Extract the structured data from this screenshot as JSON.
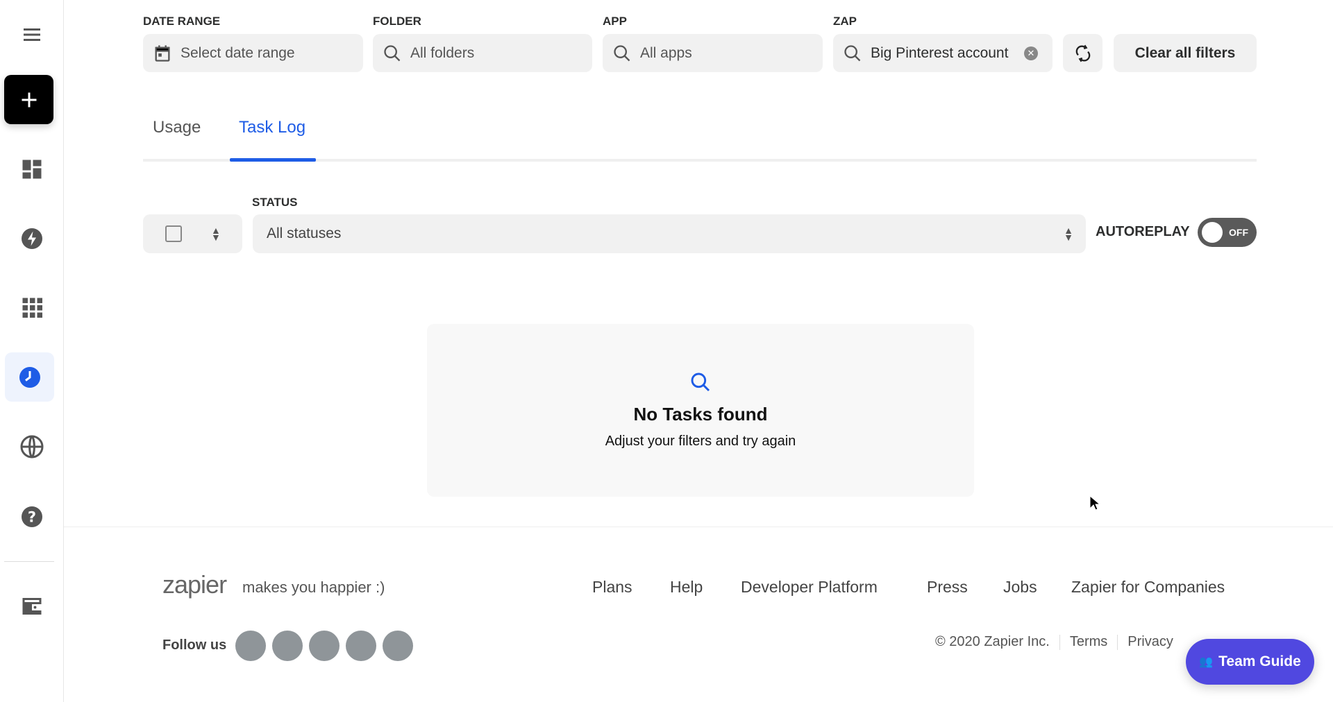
{
  "sidebar": {
    "items": [
      {
        "name": "menu",
        "icon": "hamburger-menu-icon"
      },
      {
        "name": "create",
        "icon": "plus-icon"
      },
      {
        "name": "dashboard",
        "icon": "dashboard-icon"
      },
      {
        "name": "zaps",
        "icon": "lightning-icon"
      },
      {
        "name": "apps",
        "icon": "grid-icon"
      },
      {
        "name": "history",
        "icon": "clock-icon",
        "active": true
      },
      {
        "name": "explore",
        "icon": "globe-icon"
      },
      {
        "name": "help",
        "icon": "help-icon"
      },
      {
        "name": "billing",
        "icon": "wallet-icon"
      }
    ]
  },
  "filters": {
    "date_range": {
      "label": "DATE RANGE",
      "placeholder": "Select date range"
    },
    "folder": {
      "label": "FOLDER",
      "value": "All folders"
    },
    "app": {
      "label": "APP",
      "value": "All apps"
    },
    "zap": {
      "label": "ZAP",
      "value": "Big Pinterest account"
    },
    "clear_label": "Clear all filters"
  },
  "tabs": [
    {
      "label": "Usage",
      "active": false
    },
    {
      "label": "Task Log",
      "active": true
    }
  ],
  "tasklog": {
    "status_label": "STATUS",
    "status_value": "All statuses",
    "autoreplay_label": "AUTOREPLAY",
    "autoreplay_state": "OFF"
  },
  "empty": {
    "title": "No Tasks found",
    "subtitle": "Adjust your filters and try again"
  },
  "footer": {
    "logo": "zapier",
    "tagline": "makes you happier :)",
    "links": [
      "Plans",
      "Help",
      "Developer Platform",
      "Press",
      "Jobs",
      "Zapier for Companies"
    ],
    "follow_label": "Follow us",
    "copyright": "© 2020 Zapier Inc.",
    "terms": "Terms",
    "privacy": "Privacy"
  },
  "team_guide": "Team Guide",
  "colors": {
    "accent": "#1e5ce6",
    "team_guide": "#5048e0",
    "toggle": "#5a5a5a",
    "social": "#8f9599"
  }
}
